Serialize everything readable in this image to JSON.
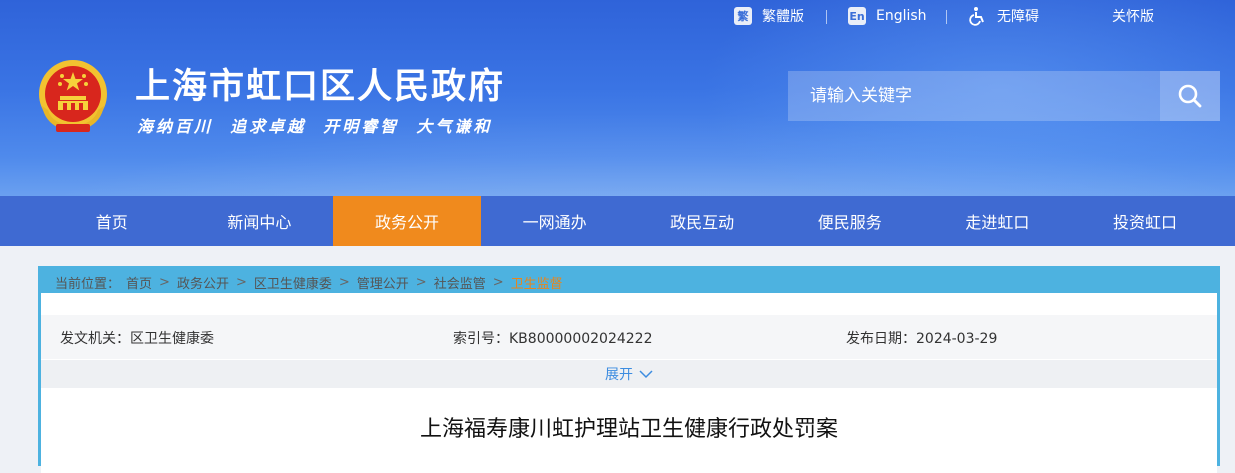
{
  "topbar": {
    "traditional": {
      "icon": "繁",
      "label": "繁體版"
    },
    "english": {
      "icon": "En",
      "label": "English"
    },
    "accessibility": {
      "label": "无障碍"
    },
    "care": {
      "label": "关怀版"
    }
  },
  "header": {
    "title": "上海市虹口区人民政府",
    "slogan": "海纳百川  追求卓越  开明睿智  大气谦和"
  },
  "search": {
    "placeholder": "请输入关键字"
  },
  "nav": {
    "items": [
      {
        "label": "首页"
      },
      {
        "label": "新闻中心"
      },
      {
        "label": "政务公开"
      },
      {
        "label": "一网通办"
      },
      {
        "label": "政民互动"
      },
      {
        "label": "便民服务"
      },
      {
        "label": "走进虹口"
      },
      {
        "label": "投资虹口"
      }
    ]
  },
  "breadcrumb": {
    "prefix": "当前位置：",
    "items": [
      "首页",
      "政务公开",
      "区卫生健康委",
      "管理公开",
      "社会监管",
      "卫生监督"
    ]
  },
  "meta": {
    "issuer": "发文机关：区卫生健康委",
    "index": "索引号：KB80000002024222",
    "date": "发布日期：2024-03-29"
  },
  "expand": {
    "label": "展开"
  },
  "document": {
    "title": "上海福寿康川虹护理站卫生健康行政处罚案"
  },
  "colors": {
    "header_blue": "#3a74e4",
    "nav_blue": "#3f6ad2",
    "active_orange": "#f08a1d",
    "panel_blue": "#4db2e0"
  }
}
